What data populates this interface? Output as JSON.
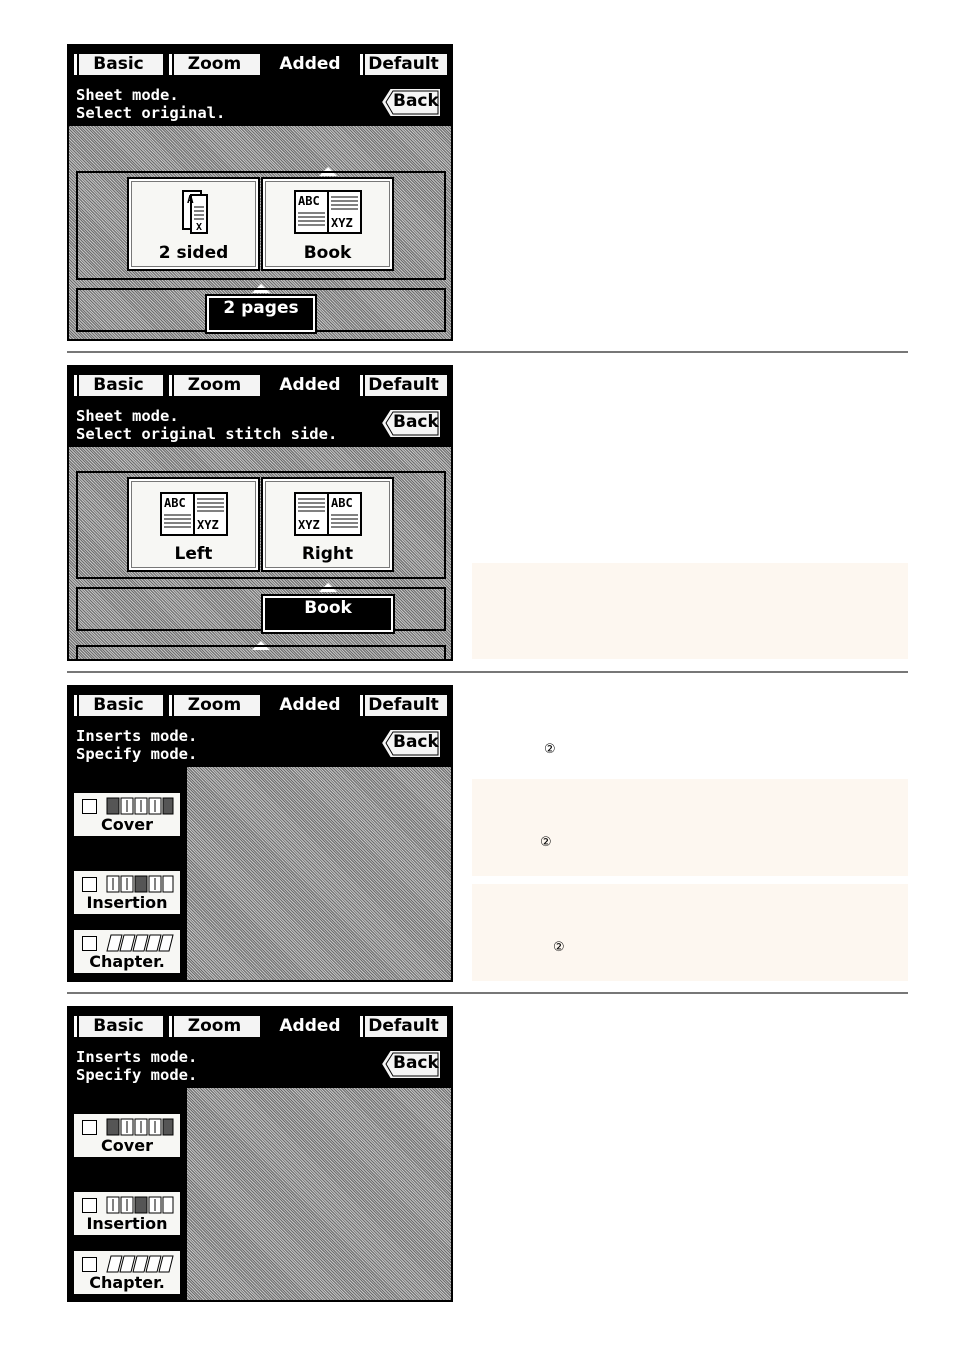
{
  "tabs": [
    "Basic",
    "Zoom",
    "Added",
    "Default"
  ],
  "active_tab": "Added",
  "back_label": "Back",
  "screen1": {
    "line1": "Sheet mode.",
    "line2": "Select original.",
    "options": [
      {
        "label": "2 sided",
        "icon": "two-sided-original-icon"
      },
      {
        "label": "Book",
        "icon": "book-original-icon"
      }
    ],
    "selected_label": "2 pages"
  },
  "screen2": {
    "line1": "Sheet mode.",
    "line2": "Select original stitch side.",
    "options": [
      {
        "label": "Left",
        "icon": "left-stitch-book-icon"
      },
      {
        "label": "Right",
        "icon": "right-stitch-book-icon"
      }
    ],
    "selected_label": "Book"
  },
  "screen3": {
    "line1": "Inserts mode.",
    "line2": "Specify mode.",
    "options": [
      {
        "label": "Cover",
        "icon": "cover-pages-icon"
      },
      {
        "label": "Insertion",
        "icon": "insertion-pages-icon"
      },
      {
        "label": "Chapter.",
        "icon": "chapter-pages-icon"
      }
    ]
  },
  "screen4": {
    "line1": "Inserts mode.",
    "line2": "Specify mode.",
    "options": [
      {
        "label": "Cover",
        "icon": "cover-pages-icon"
      },
      {
        "label": "Insertion",
        "icon": "insertion-pages-icon"
      },
      {
        "label": "Chapter.",
        "icon": "chapter-pages-icon"
      }
    ]
  },
  "markers": [
    "②",
    "②",
    "②"
  ]
}
